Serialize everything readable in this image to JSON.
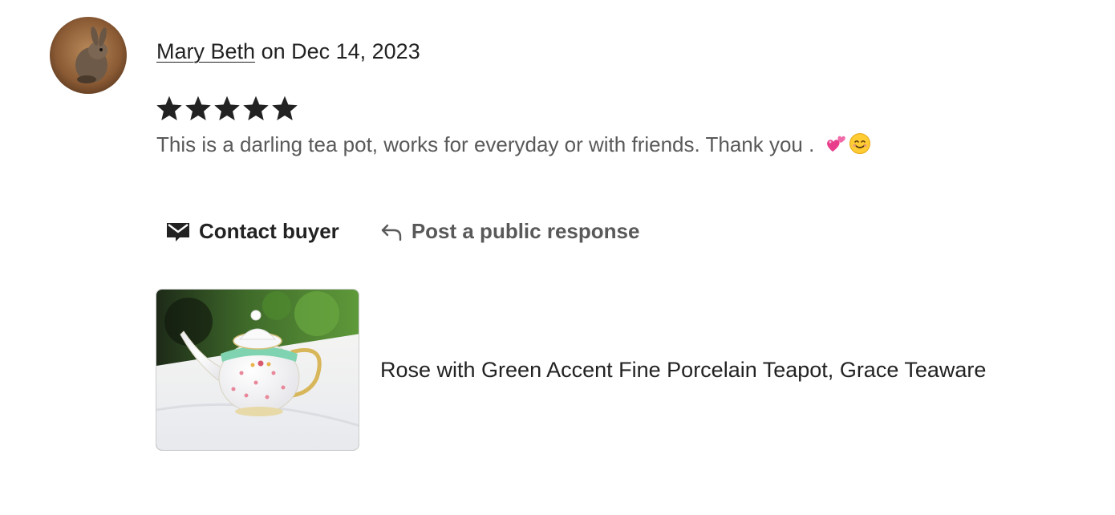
{
  "review": {
    "reviewer_name": "Mary Beth",
    "date_text": "on Dec 14, 2023",
    "rating": 5,
    "max_rating": 5,
    "text": "This is a darling tea pot, works for everyday or with friends. Thank you . ",
    "emojis": [
      "two-hearts-emoji",
      "smiling-face-emoji"
    ]
  },
  "actions": {
    "contact_label": "Contact buyer",
    "respond_label": "Post a public response",
    "contact_icon": "mail-icon",
    "respond_icon": "reply-arrow-icon"
  },
  "listing": {
    "title": "Rose with Green Accent Fine Porcelain Teapot, Grace Teaware"
  },
  "colors": {
    "primary_text": "#222222",
    "secondary_text": "#595959",
    "star": "#222222",
    "thumb_border": "#cccccc"
  }
}
